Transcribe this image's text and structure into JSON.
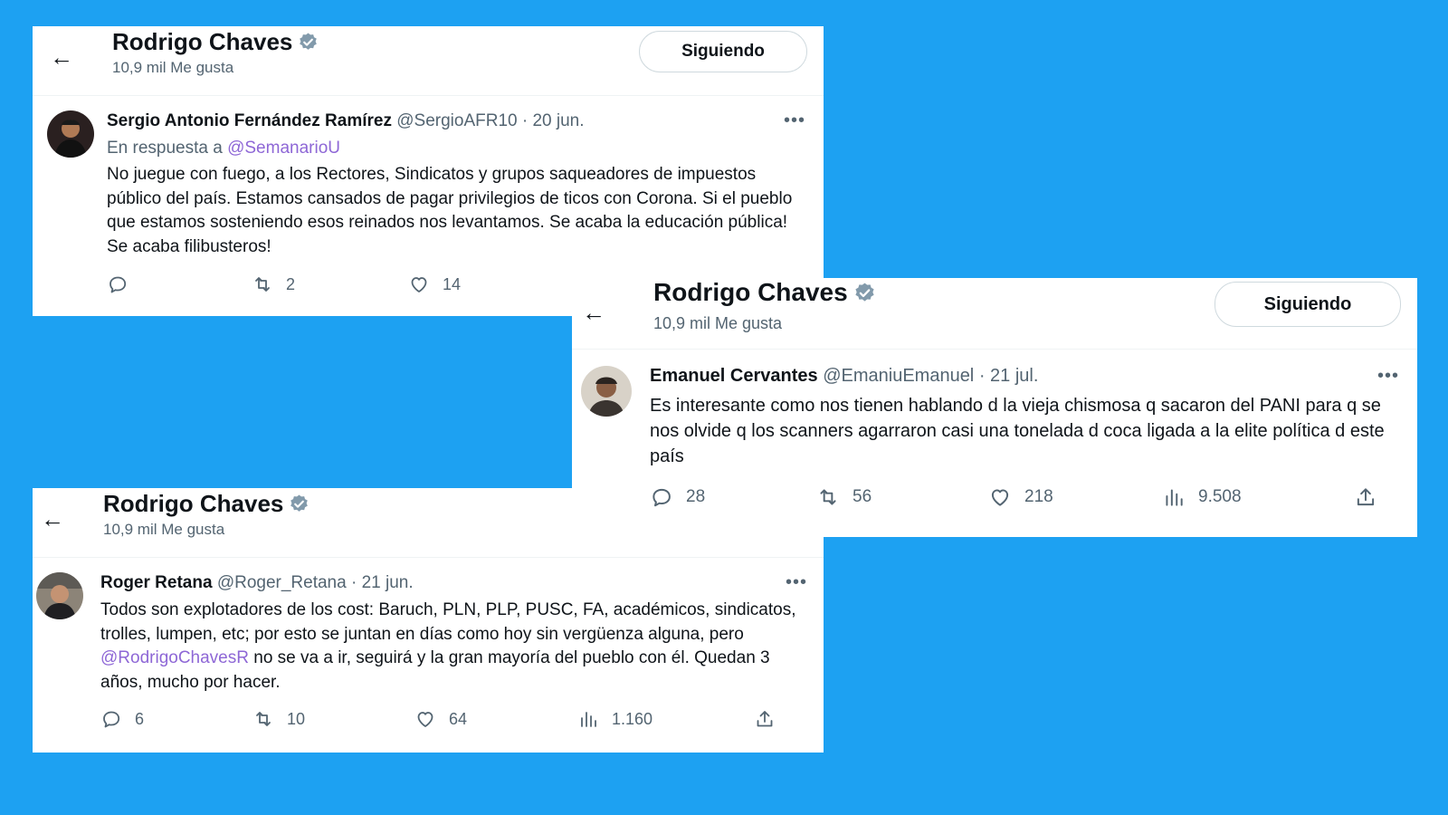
{
  "colors": {
    "background": "#1DA1F2",
    "link": "#8e67d6",
    "verified": "#829aab",
    "muted": "#536471"
  },
  "profile": {
    "name": "Rodrigo Chaves",
    "likes_label": "10,9 mil Me gusta",
    "follow_label": "Siguiendo"
  },
  "tweet1": {
    "author": "Sergio Antonio Fernández Ramírez",
    "handle": "@SergioAFR10",
    "date": "· 20 jun.",
    "reply_prefix": "En respuesta a ",
    "reply_handle": "@SemanarioU",
    "text": "No juegue con fuego, a los Rectores, Sindicatos y grupos saqueadores de impuestos público del país. Estamos cansados de pagar privilegios de ticos con Corona. Si el pueblo que estamos sosteniendo esos reinados nos levantamos. Se acaba la educación pública! Se acaba filibusteros!",
    "retweets": "2",
    "likes": "14"
  },
  "tweet2": {
    "author": "Emanuel Cervantes",
    "handle": "@EmaniuEmanuel",
    "date": "· 21 jul.",
    "text": "Es interesante como nos tienen hablando d la vieja chismosa q sacaron del PANI para q se nos olvide q los scanners agarraron casi una tonelada d coca ligada a la elite política d este país",
    "replies": "28",
    "retweets": "56",
    "likes": "218",
    "views": "9.508"
  },
  "tweet3": {
    "author": "Roger Retana",
    "handle": "@Roger_Retana",
    "date": "· 21 jun.",
    "text_before": "Todos son explotadores de los cost: Baruch, PLN, PLP, PUSC, FA, académicos, sindicatos, trolles, lumpen, etc; por esto se juntan en días como hoy sin vergüenza alguna, pero ",
    "mention": "@RodrigoChavesR",
    "text_after": " no se va a ir, seguirá y la gran mayoría del pueblo con él. Quedan 3 años, mucho por hacer.",
    "replies": "6",
    "retweets": "10",
    "likes": "64",
    "views": "1.160"
  }
}
